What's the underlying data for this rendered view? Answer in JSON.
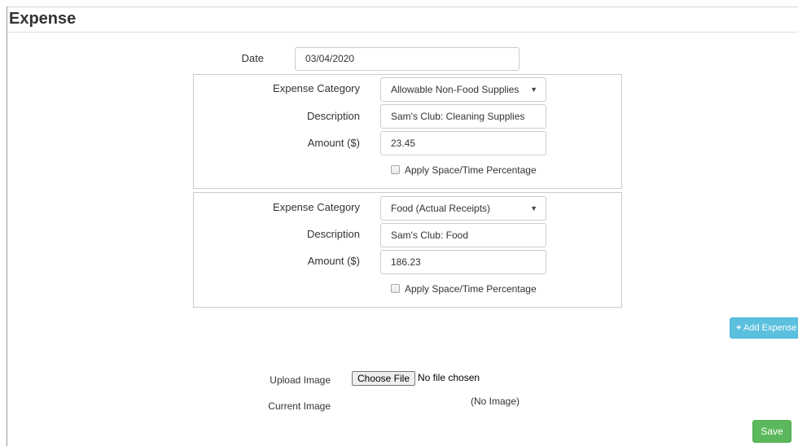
{
  "page": {
    "title": "Expense"
  },
  "date": {
    "label": "Date",
    "value": "03/04/2020"
  },
  "expenses": [
    {
      "category_label": "Expense Category",
      "category_value": "Allowable Non-Food Supplies",
      "description_label": "Description",
      "description_value": "Sam's Club: Cleaning Supplies",
      "amount_label": "Amount ($)",
      "amount_value": "23.45",
      "apply_label": "Apply Space/Time Percentage",
      "apply_checked": false
    },
    {
      "category_label": "Expense Category",
      "category_value": "Food (Actual Receipts)",
      "description_label": "Description",
      "description_value": "Sam's Club: Food",
      "amount_label": "Amount ($)",
      "amount_value": "186.23",
      "apply_label": "Apply Space/Time Percentage",
      "apply_checked": false
    }
  ],
  "actions": {
    "add_expense_label": "Add Expense",
    "add_icon": "plus-icon",
    "save_label": "Save"
  },
  "upload": {
    "label": "Upload Image",
    "button_label": "Choose File",
    "status": "No file chosen"
  },
  "current_image": {
    "label": "Current Image",
    "value": "(No Image)"
  },
  "colors": {
    "add_button": "#5bc0de",
    "save_button": "#5cb85c"
  }
}
